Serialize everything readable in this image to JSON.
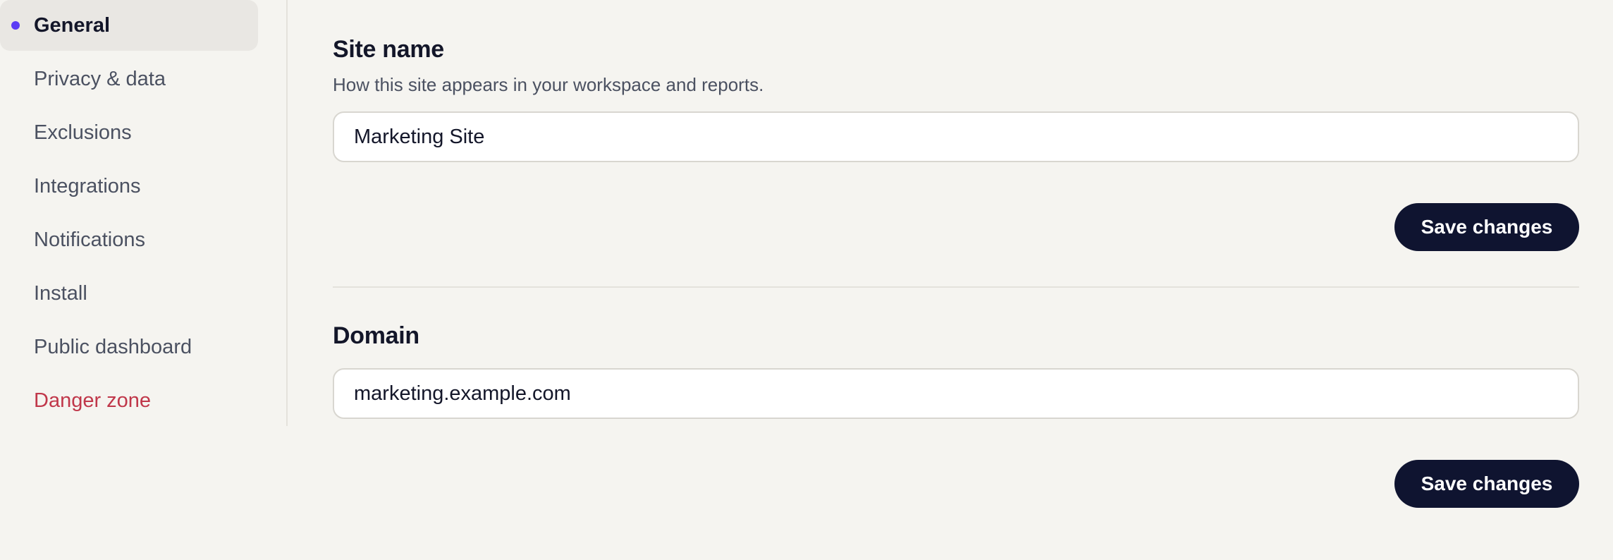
{
  "sidebar": {
    "items": [
      {
        "label": "General",
        "active": true
      },
      {
        "label": "Privacy & data"
      },
      {
        "label": "Exclusions"
      },
      {
        "label": "Integrations"
      },
      {
        "label": "Notifications"
      },
      {
        "label": "Install"
      },
      {
        "label": "Public dashboard"
      },
      {
        "label": "Danger zone",
        "danger": true
      }
    ]
  },
  "site_name": {
    "title": "Site name",
    "description": "How this site appears in your workspace and reports.",
    "value": "Marketing Site",
    "save_label": "Save changes"
  },
  "domain": {
    "title": "Domain",
    "value": "marketing.example.com",
    "save_label": "Save changes"
  },
  "colors": {
    "accent": "#5b3df5",
    "danger": "#c0374a",
    "primary_button": "#0f1430",
    "background": "#f5f4f0"
  }
}
